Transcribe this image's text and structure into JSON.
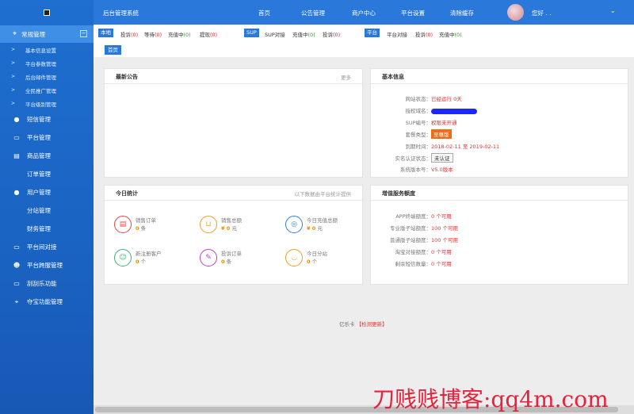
{
  "topbar": {
    "title": "后台管理系统",
    "nav": [
      "首页",
      "公告管理",
      "商户中心",
      "平台设置",
      "清除缓存"
    ],
    "greeting": "您好 . .",
    "dropdown_icon": "chevron-down-icon"
  },
  "sidebar": {
    "logo_icon": "logo-icon",
    "group": {
      "label": "常规管理",
      "icon": "crosshair-icon",
      "collapse": "−"
    },
    "subitems": [
      "基本信息设置",
      "平台参数管理",
      "后台邮件管理",
      "全民推广管理",
      "平台级别管理"
    ],
    "items": [
      {
        "label": "短信管理",
        "icon": "location-icon"
      },
      {
        "label": "平台管理",
        "icon": "monitor-icon"
      },
      {
        "label": "商品管理",
        "icon": "cart-icon"
      },
      {
        "label": "订单管理",
        "icon": ""
      },
      {
        "label": "用户管理",
        "icon": "location-icon"
      },
      {
        "label": "分站管理",
        "icon": ""
      },
      {
        "label": "财务管理",
        "icon": ""
      },
      {
        "label": "平台间对接",
        "icon": "monitor-icon"
      },
      {
        "label": "平台跨服管理",
        "icon": "user-icon"
      },
      {
        "label": "刮刮乐功能",
        "icon": "monitor-icon"
      },
      {
        "label": "夺宝功能管理",
        "icon": "crosshair-icon"
      }
    ]
  },
  "statusbar": {
    "local": {
      "tag": "本地",
      "items": [
        {
          "label": "投诉",
          "count": "(0)"
        },
        {
          "label": "等待",
          "count": "(0)"
        },
        {
          "label": "充值中",
          "count": "(0)"
        },
        {
          "label": "提现",
          "count": "(0)"
        }
      ]
    },
    "sup": {
      "tag": "SUP",
      "items": [
        {
          "label": "SUP对接",
          "count": ""
        },
        {
          "label": "充值中",
          "count": "(0)"
        },
        {
          "label": "投诉",
          "count": "(0)"
        }
      ]
    },
    "platform": {
      "tag": "平台",
      "items": [
        {
          "label": "平台对接",
          "count": ""
        },
        {
          "label": "投诉",
          "count": "(0)"
        },
        {
          "label": "充值中",
          "count": "(0)"
        }
      ]
    }
  },
  "breadcrumb": {
    "home": "首页"
  },
  "announcement": {
    "title": "最新公告",
    "more": "更多"
  },
  "basic_info": {
    "title": "基本信息",
    "rows": [
      {
        "key": "网站状态：",
        "value": "已经运行 0天"
      },
      {
        "key": "授权域名：",
        "value": ""
      },
      {
        "key": "SUP编号：",
        "value": "权限未开通"
      },
      {
        "key": "套餐类型：",
        "value": "至尊版"
      },
      {
        "key": "到期时间：",
        "value": "2018-02-11 至 2019-02-11"
      },
      {
        "key": "实名认证状态：",
        "value": "未认证"
      },
      {
        "key": "系统版本号：",
        "value": "V5.0版本"
      }
    ]
  },
  "today_stats": {
    "title": "今日统计",
    "note": "以下数据由平台统计提供",
    "items": [
      {
        "label": "销售订单",
        "value": "0",
        "unit": "条",
        "icon": "document-icon",
        "color": "#e54545"
      },
      {
        "label": "销售总额",
        "value": "¥ 0",
        "unit": "元",
        "icon": "cart-icon",
        "color": "#f59a23"
      },
      {
        "label": "今日充值总额",
        "value": "¥ 0",
        "unit": "元",
        "icon": "coins-icon",
        "color": "#2f80d8"
      },
      {
        "label": "新注册客户",
        "value": "0",
        "unit": "个",
        "icon": "user-icon",
        "color": "#3cb371"
      },
      {
        "label": "投诉订单",
        "value": "0",
        "unit": "条",
        "icon": "edit-icon",
        "color": "#c23bc2"
      },
      {
        "label": "今日分站",
        "value": "0",
        "unit": "个",
        "icon": "shield-icon",
        "color": "#f59a23"
      }
    ]
  },
  "value_added": {
    "title": "增值服务额度",
    "rows": [
      {
        "key": "APP终端额度：",
        "value": "0 个可用"
      },
      {
        "key": "专业版子站额度：",
        "value": "100 个可用"
      },
      {
        "key": "普通版子站额度：",
        "value": "100 个可用"
      },
      {
        "key": "淘宝对接额度：",
        "value": "0 个可用"
      },
      {
        "key": "剩余短信数量：",
        "value": "0 个可用"
      }
    ]
  },
  "footer": {
    "brand": "亿乐卡",
    "link": "【检测更新】"
  },
  "watermark": "刀贱贱博客:qq4m.com",
  "colors": {
    "primary": "#2a78d9",
    "sidebar": "#1e6fd0",
    "red": "#e03030",
    "orange": "#f26a16"
  }
}
